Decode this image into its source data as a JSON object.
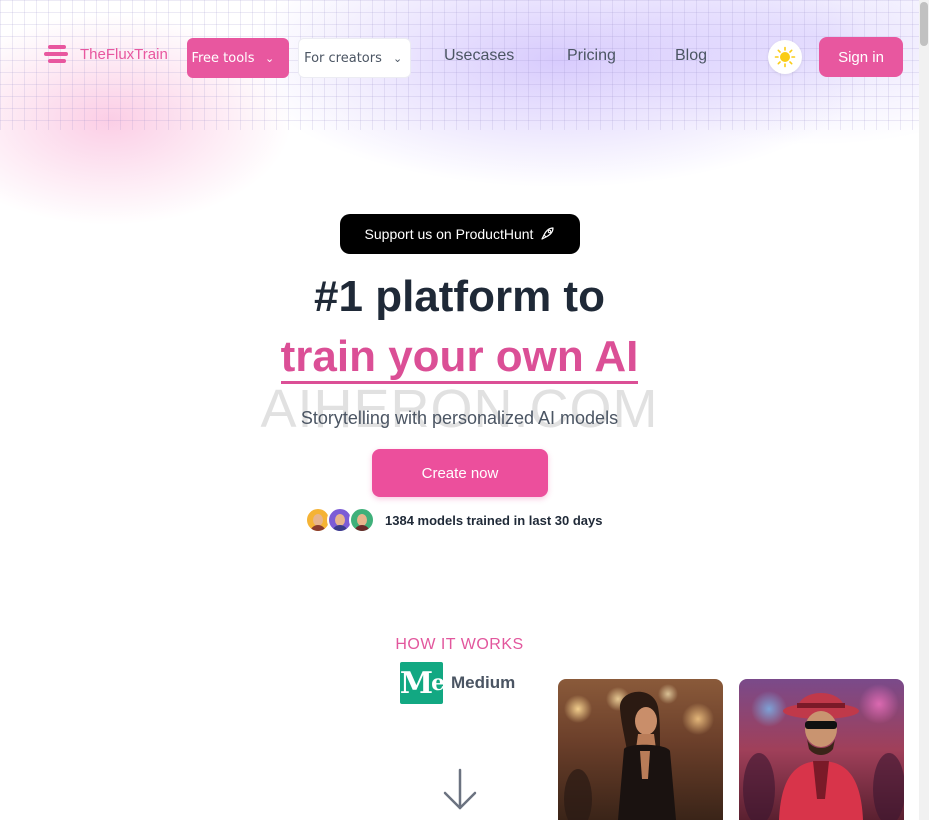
{
  "nav": {
    "brand": "TheFluxTrain",
    "free_tools": "Free tools",
    "for_creators": "For creators",
    "links": [
      "Usecases",
      "Pricing",
      "Blog"
    ],
    "sign_in": "Sign in"
  },
  "hero": {
    "producthunt": "Support us on ProductHunt",
    "headline_line1": "#1 platform to",
    "headline_line2": "train your own AI",
    "watermark": "AIHERON.COM",
    "subtitle": "Storytelling with personalized AI models",
    "cta": "Create now",
    "social_proof": "1384 models trained in last 30 days"
  },
  "how_it_works": {
    "heading": "HOW IT WORKS",
    "medium_logo": "M",
    "medium_label": "Medium"
  },
  "colors": {
    "accent": "#e8579f",
    "text_dark": "#1f2937",
    "text_muted": "#4b5563",
    "medium_green": "#12a882"
  },
  "icons": [
    "menu-logo-icon",
    "chevron-down-icon",
    "sun-icon",
    "rocket-icon",
    "arrow-down-icon"
  ]
}
